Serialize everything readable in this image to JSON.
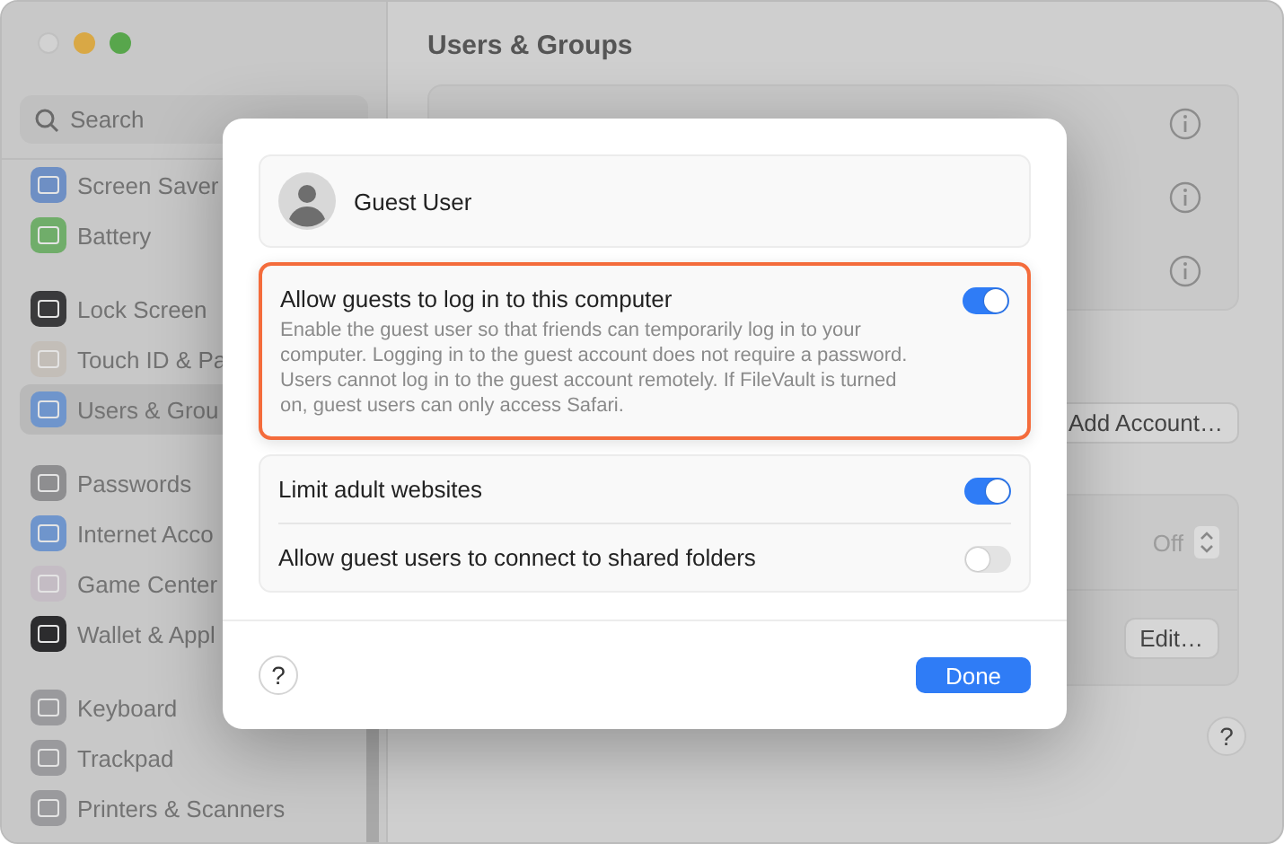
{
  "window": {
    "title": "Users & Groups"
  },
  "sidebar": {
    "search": {
      "placeholder": "Search"
    },
    "groups": [
      [
        {
          "label": "Screen Saver",
          "color": "#6e8fc4",
          "selected": false
        },
        {
          "label": "Battery",
          "color": "#70ad6a",
          "selected": false
        }
      ],
      [
        {
          "label": "Lock Screen",
          "color": "#3a3a3c",
          "selected": false
        },
        {
          "label": "Touch ID & Pa",
          "color": "#c3beb8",
          "selected": false
        },
        {
          "label": "Users & Grou",
          "color": "#6f95cc",
          "selected": true
        }
      ],
      [
        {
          "label": "Passwords",
          "color": "#8e8e90",
          "selected": false
        },
        {
          "label": "Internet Acco",
          "color": "#6f95cc",
          "selected": false
        },
        {
          "label": "Game Center",
          "color": "#c4bcc4",
          "selected": false
        },
        {
          "label": "Wallet & Appl",
          "color": "#2c2c2e",
          "selected": false
        }
      ],
      [
        {
          "label": "Keyboard",
          "color": "#9a9a9d",
          "selected": false
        },
        {
          "label": "Trackpad",
          "color": "#9a9a9d",
          "selected": false
        },
        {
          "label": "Printers & Scanners",
          "color": "#9a9a9d",
          "selected": false
        }
      ]
    ]
  },
  "content": {
    "add_account_button": "Add Account…",
    "auto_login_value": "Off",
    "edit_button": "Edit…",
    "help_button": "?"
  },
  "dialog": {
    "user_name": "Guest User",
    "cards": [
      {
        "highlighted": true,
        "rows": [
          {
            "label": "Allow guests to log in to this computer",
            "description": "Enable the guest user so that friends can temporarily log in to your computer. Logging in to the guest account does not require a password. Users cannot log in to the guest account remotely. If FileVault is turned on, guest users can only access Safari.",
            "on": true
          }
        ]
      },
      {
        "highlighted": false,
        "rows": [
          {
            "label": "Limit adult websites",
            "on": true
          },
          {
            "label": "Allow guest users to connect to shared folders",
            "on": false
          }
        ]
      }
    ],
    "help_button": "?",
    "done_button": "Done"
  }
}
